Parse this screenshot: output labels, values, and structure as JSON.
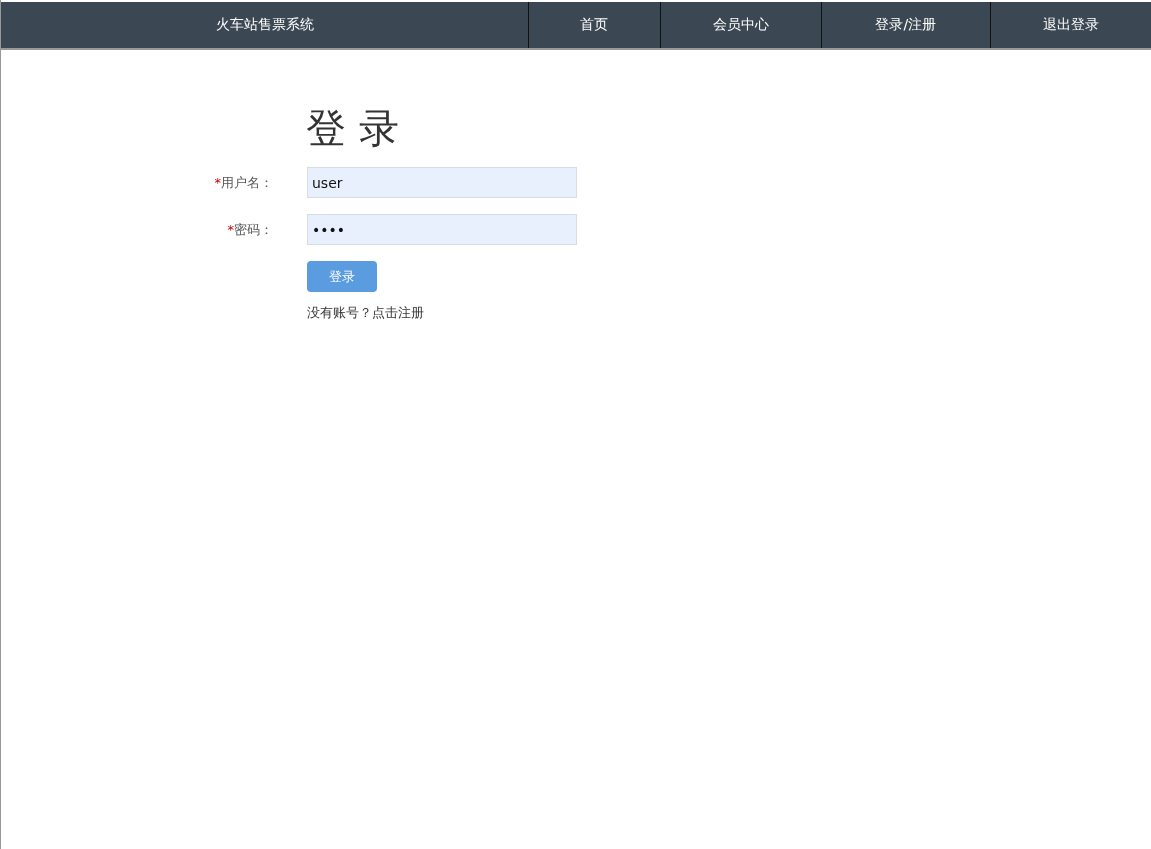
{
  "navbar": {
    "brand": "火车站售票系统",
    "items": [
      {
        "label": "首页"
      },
      {
        "label": "会员中心"
      },
      {
        "label": "登录/注册"
      },
      {
        "label": "退出登录"
      }
    ]
  },
  "form": {
    "title": "登 录",
    "fields": [
      {
        "mark": "*",
        "label": "用户名：",
        "value": "user"
      },
      {
        "mark": "*",
        "label": "密码：",
        "value": "••••"
      }
    ],
    "submit": "登录",
    "footer": "没有账号？点击注册"
  }
}
